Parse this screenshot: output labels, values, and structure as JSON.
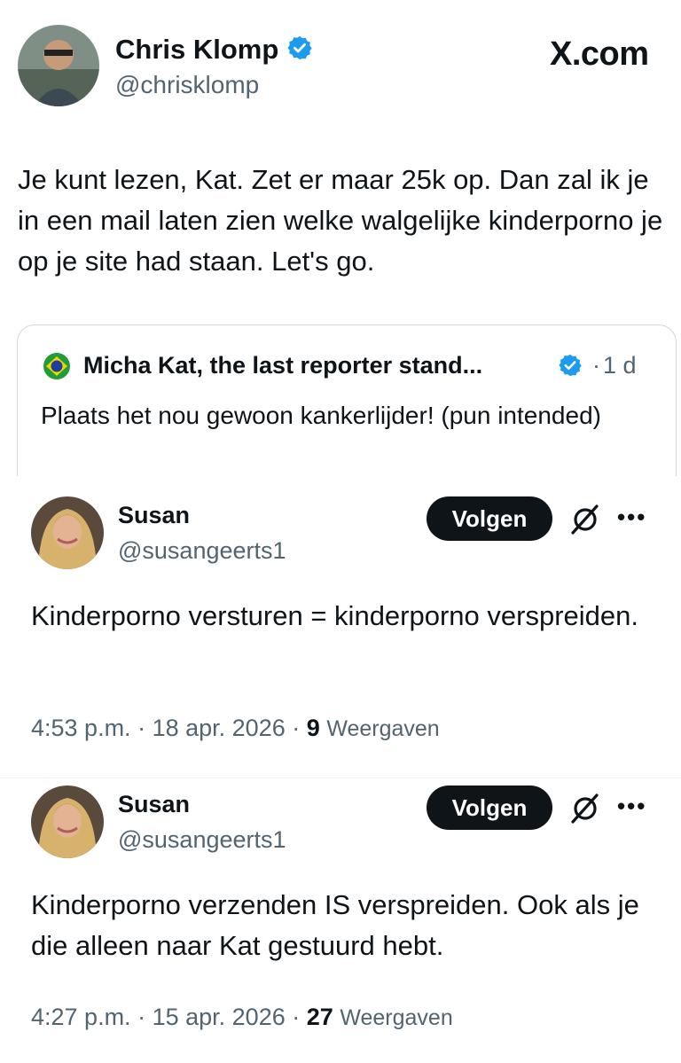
{
  "main_tweet": {
    "author_name": "Chris Klomp",
    "author_handle": "@chrisklomp",
    "brand": "X.com",
    "text": "Je kunt lezen, Kat. Zet er maar 25k op. Dan zal ik je in een mail laten zien welke walgelijke kinderporno je op je site had staan. Let's go."
  },
  "quoted_tweet": {
    "author_name": "Micha Kat, the last reporter stand...",
    "separator": "·",
    "time": "1 d",
    "text": "Plaats het nou gewoon kankerlijder! (pun intended)"
  },
  "replies": [
    {
      "author_name": "Susan",
      "author_handle": "@susangeerts1",
      "follow_label": "Volgen",
      "more_label": "•••",
      "text": "Kinderporno versturen = kinderporno verspreiden.",
      "time": "4:53 p.m.",
      "date": "18 apr. 2026",
      "views_count": "9",
      "views_label": "Weergaven"
    },
    {
      "author_name": "Susan",
      "author_handle": "@susangeerts1",
      "follow_label": "Volgen",
      "more_label": "•••",
      "text": "Kinderporno verzenden IS verspreiden. Ook als je die alleen naar Kat gestuurd hebt.",
      "time": "4:27 p.m.",
      "date": "15 apr. 2026",
      "views_count": "27",
      "views_label": "Weergaven"
    }
  ],
  "meta_separator": "·",
  "colors": {
    "verified": "#1d9bf0",
    "text_primary": "#0f1419",
    "text_secondary": "#536471",
    "button_bg": "#0f1419"
  },
  "icons": [
    "verified-badge-icon",
    "brazil-flag-icon",
    "grok-icon",
    "more-icon"
  ]
}
